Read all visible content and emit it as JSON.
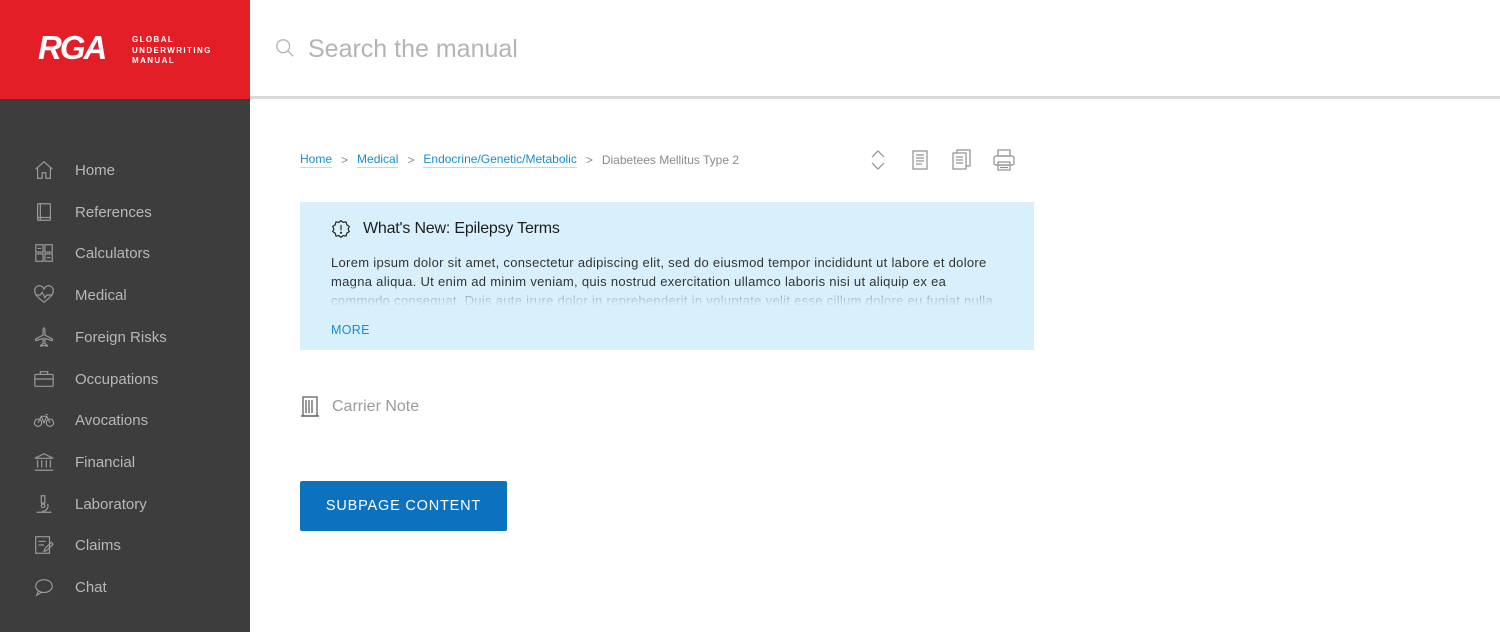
{
  "logo": {
    "mark": "RGA",
    "text_line1": "GLOBAL",
    "text_line2": "UNDERWRITING",
    "text_line3": "MANUAL",
    "background": "#e41e26"
  },
  "search": {
    "placeholder": "Search the manual",
    "value": "",
    "icon": "search-icon"
  },
  "sidebar": {
    "background": "#3d3d3d",
    "items": [
      {
        "label": "Home",
        "icon": "home-icon"
      },
      {
        "label": "References",
        "icon": "book-icon"
      },
      {
        "label": "Calculators",
        "icon": "calculator-icon"
      },
      {
        "label": "Medical",
        "icon": "heartbeat-icon"
      },
      {
        "label": "Foreign Risks",
        "icon": "airplane-icon"
      },
      {
        "label": "Occupations",
        "icon": "briefcase-icon"
      },
      {
        "label": "Avocations",
        "icon": "bicycle-icon"
      },
      {
        "label": "Financial",
        "icon": "bank-icon"
      },
      {
        "label": "Laboratory",
        "icon": "microscope-icon"
      },
      {
        "label": "Claims",
        "icon": "edit-document-icon"
      },
      {
        "label": "Chat",
        "icon": "chat-bubble-icon"
      }
    ]
  },
  "breadcrumb": {
    "items": [
      "Home",
      "Medical",
      "Endocrine/Genetic/Metabolic"
    ],
    "separator": ">",
    "current": "Diabetees Mellitus Type 2"
  },
  "toolbar": {
    "icons": [
      "expand-collapse-icon",
      "document-icon",
      "documents-icon",
      "print-icon"
    ]
  },
  "notice": {
    "title": "What's New: Epilepsy Terms",
    "body": "Lorem ipsum dolor sit amet, consectetur adipiscing elit, sed do eiusmod tempor incididunt ut labore et dolore magna aliqua. Ut enim ad minim veniam, quis nostrud exercitation ullamco laboris nisi ut aliquip ex ea commodo consequat. Duis aute irure dolor in reprehenderit in voluptate velit esse cillum dolore eu fugiat nulla",
    "more_label": "MORE",
    "background": "#d8f0fc",
    "icon": "alert-badge-icon"
  },
  "carrier_note": {
    "label": "Carrier Note",
    "icon": "building-icon"
  },
  "subpage_button": {
    "label": "SUBPAGE CONTENT",
    "color": "#0c72c0"
  },
  "colors": {
    "link": "#1a8bd3",
    "accent_red": "#e41e26"
  }
}
